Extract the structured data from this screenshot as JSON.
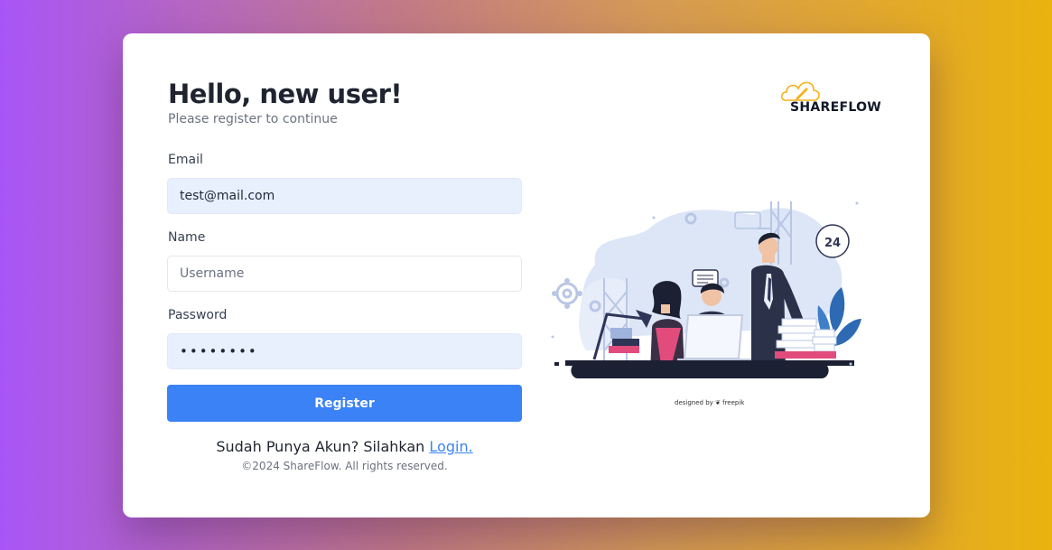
{
  "form": {
    "title": "Hello, new user!",
    "subtitle": "Please register to continue",
    "email_label": "Email",
    "email_value": "test@mail.com",
    "name_label": "Name",
    "name_placeholder": "Username",
    "password_label": "Password",
    "password_value": "testtest",
    "register_label": "Register",
    "login_prompt": "Sudah Punya Akun? Silahkan",
    "login_link": "Login.",
    "copyright": "©2024 ShareFlow. All rights reserved."
  },
  "brand": {
    "logo_text": "SHAREFLOW",
    "logo_icon": "cloud-pen-icon",
    "accent": "#3b82f6",
    "logo_accent": "#f5b21a"
  },
  "illustration": {
    "badge_text": "24",
    "credit": "designed by ❦ freepik"
  },
  "colors": {
    "gradient_start": "#a855f7",
    "gradient_end": "#eab30e",
    "input_filled_bg": "#e8effd"
  }
}
